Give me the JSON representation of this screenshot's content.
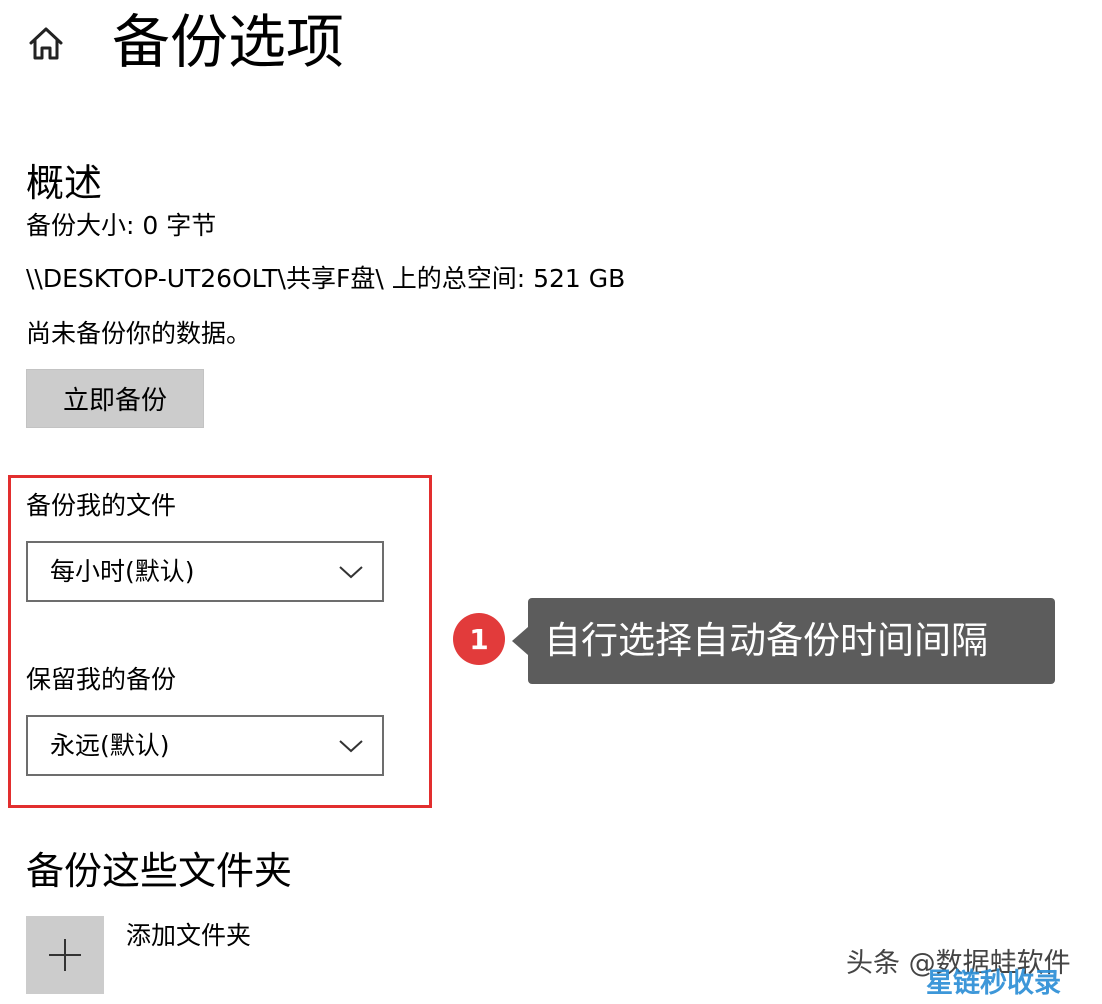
{
  "header": {
    "home_icon": "home-icon",
    "title": "备份选项"
  },
  "overview": {
    "title": "概述",
    "backup_size": "备份大小: 0 字节",
    "total_space": "\\\\DESKTOP-UT26OLT\\共享F盘\\ 上的总空间: 521 GB",
    "status": "尚未备份你的数据。",
    "backup_now_label": "立即备份"
  },
  "schedule": {
    "frequency_label": "备份我的文件",
    "frequency_value": "每小时(默认)",
    "retention_label": "保留我的备份",
    "retention_value": "永远(默认)"
  },
  "annotation": {
    "step_number": "1",
    "text": "自行选择自动备份时间间隔",
    "highlight_color": "#e22e2e",
    "badge_color": "#e23b3b",
    "callout_color": "#5c5c5c"
  },
  "folders": {
    "title": "备份这些文件夹",
    "add_label": "添加文件夹",
    "add_icon": "plus-icon"
  },
  "watermark": {
    "text": "头条 @数据蛙软件",
    "overlay_text": "星链秒收录"
  }
}
